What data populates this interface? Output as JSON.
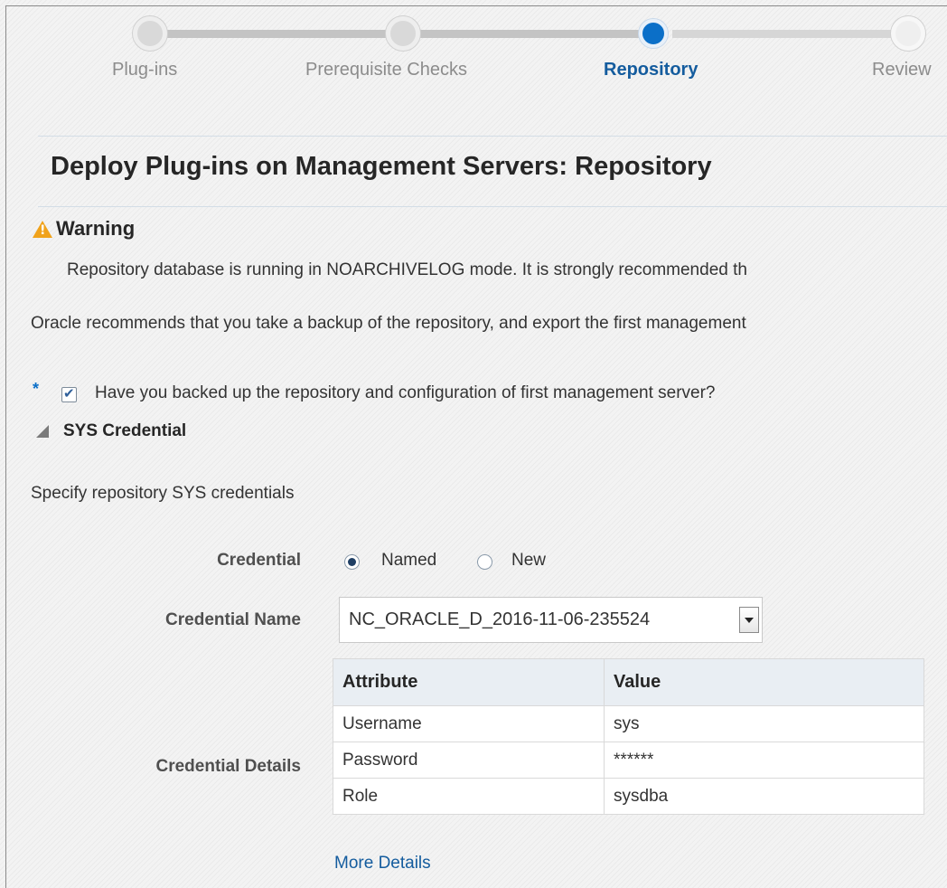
{
  "train": {
    "steps": [
      {
        "label": "Plug-ins",
        "state": "done"
      },
      {
        "label": "Prerequisite Checks",
        "state": "done"
      },
      {
        "label": "Repository",
        "state": "active"
      },
      {
        "label": "Review",
        "state": "future"
      }
    ]
  },
  "page": {
    "title": "Deploy Plug-ins on Management Servers: Repository"
  },
  "warning": {
    "title": "Warning",
    "message": "Repository database is running in NOARCHIVELOG mode. It is strongly recommended th"
  },
  "recommendation": "Oracle recommends that you take a backup of the repository, and export the first management",
  "backup_confirm": {
    "required_marker": "*",
    "label": "Have you backed up the repository and configuration of first management server?",
    "checked": true
  },
  "sys_credential": {
    "section_title": "SYS Credential",
    "description": "Specify repository SYS credentials",
    "credential_label": "Credential",
    "options": [
      {
        "label": "Named",
        "selected": true
      },
      {
        "label": "New",
        "selected": false
      }
    ],
    "credential_name_label": "Credential Name",
    "credential_name_value": "NC_ORACLE_D_2016-11-06-235524",
    "credential_details_label": "Credential Details",
    "details_table": {
      "headers": [
        "Attribute",
        "Value"
      ],
      "rows": [
        [
          "Username",
          "sys"
        ],
        [
          "Password",
          "******"
        ],
        [
          "Role",
          "sysdba"
        ]
      ]
    },
    "more_details_link": "More Details"
  },
  "colors": {
    "active_step": "#0b6fc8",
    "link": "#145c9e",
    "warning": "#f0a21b"
  }
}
